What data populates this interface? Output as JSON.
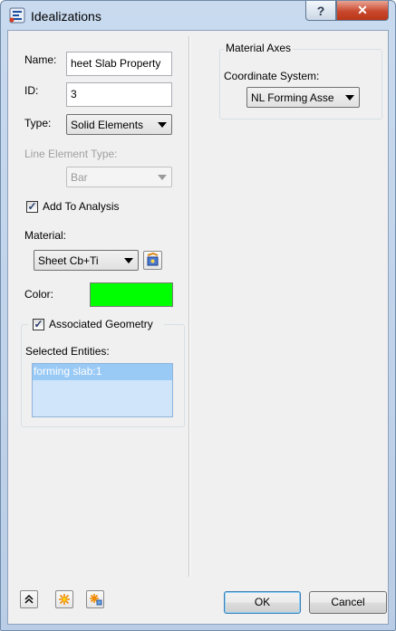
{
  "window": {
    "title": "Idealizations",
    "help_glyph": "?",
    "close_glyph": "✕"
  },
  "left": {
    "name_label": "Name:",
    "name_value": "heet Slab Property",
    "id_label": "ID:",
    "id_value": "3",
    "type_label": "Type:",
    "type_value": "Solid Elements",
    "line_element_type_label": "Line Element Type:",
    "line_element_type_value": "Bar",
    "add_to_analysis_label": "Add To Analysis",
    "add_to_analysis_checked": true,
    "material_label": "Material:",
    "material_value": "Sheet Cb+Ti",
    "color_label": "Color:",
    "color_value": "#00ff00",
    "associated_geometry_label": "Associated Geometry",
    "associated_geometry_checked": true,
    "selected_entities_label": "Selected Entities:",
    "selected_entities": [
      "forming slab:1"
    ]
  },
  "right": {
    "material_axes_title": "Material Axes",
    "coordinate_system_label": "Coordinate System:",
    "coordinate_system_value": "NL Forming Asse"
  },
  "footer": {
    "ok_label": "OK",
    "cancel_label": "Cancel",
    "collapse_glyph": "≈",
    "tool_glyph": "✳"
  },
  "colors": {
    "selection": "#99c9f5",
    "list_bg": "#d1e5fa",
    "color_swatch": "#00ff00"
  }
}
